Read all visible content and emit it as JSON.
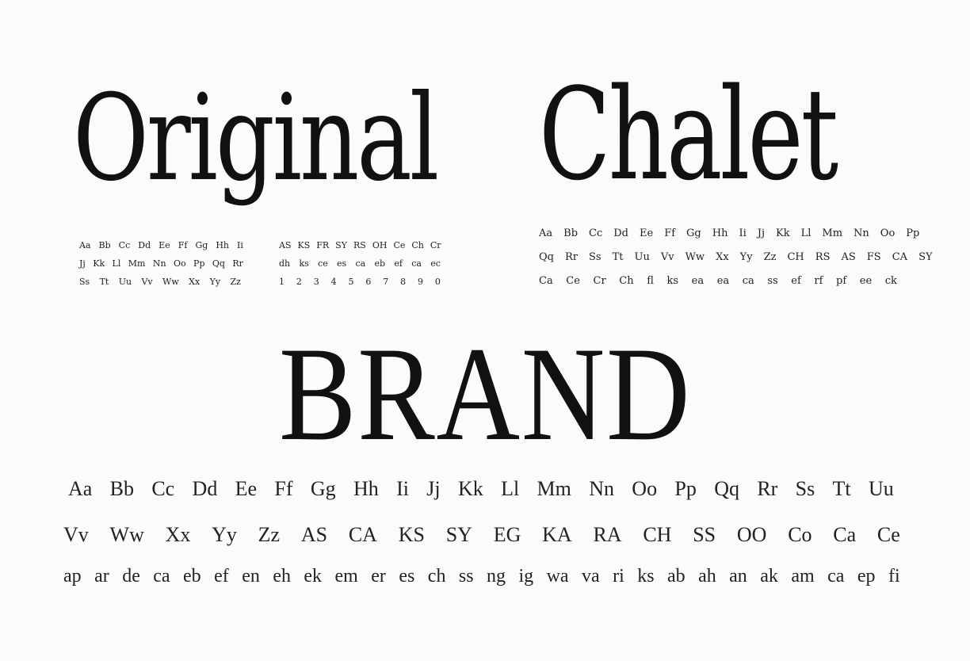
{
  "specimens": {
    "original": {
      "name": "Original",
      "left_rows": [
        [
          "Aa",
          "Bb",
          "Cc",
          "Dd",
          "Ee",
          "Ff",
          "Gg",
          "Hh",
          "Ii"
        ],
        [
          "Jj",
          "Kk",
          "Ll",
          "Mm",
          "Nn",
          "Oo",
          "Pp",
          "Qq",
          "Rr"
        ],
        [
          "Ss",
          "Tt",
          "Uu",
          "Vv",
          "Ww",
          "Xx",
          "Yy",
          "Zz"
        ]
      ],
      "right_rows": [
        [
          "AS",
          "KS",
          "FR",
          "SY",
          "RS",
          "OH",
          "Ce",
          "Ch",
          "Cr"
        ],
        [
          "dh",
          "ks",
          "ce",
          "es",
          "ca",
          "eb",
          "ef",
          "ca",
          "ec"
        ],
        [
          "1",
          "2",
          "3",
          "4",
          "5",
          "6",
          "7",
          "8",
          "9",
          "0"
        ]
      ]
    },
    "chalet": {
      "name": "Chalet",
      "rows": [
        [
          "Aa",
          "Bb",
          "Cc",
          "Dd",
          "Ee",
          "Ff",
          "Gg",
          "Hh",
          "Ii",
          "Jj",
          "Kk",
          "Ll",
          "Mm",
          "Nn",
          "Oo",
          "Pp"
        ],
        [
          "Qq",
          "Rr",
          "Ss",
          "Tt",
          "Uu",
          "Vv",
          "Ww",
          "Xx",
          "Yy",
          "Zz",
          "CH",
          "RS",
          "AS",
          "FS",
          "CA",
          "SY"
        ],
        [
          "Ca",
          "Ce",
          "Cr",
          "Ch",
          "fl",
          "ks",
          "ea",
          "ea",
          "ca",
          "ss",
          "ef",
          "rf",
          "pf",
          "ee",
          "ck"
        ]
      ]
    },
    "brand": {
      "name": "BRAND",
      "alpha_row_1": [
        "Aa",
        "Bb",
        "Cc",
        "Dd",
        "Ee",
        "Ff",
        "Gg",
        "Hh",
        "Ii",
        "Jj",
        "Kk",
        "Ll",
        "Mm",
        "Nn",
        "Oo",
        "Pp",
        "Qq",
        "Rr",
        "Ss",
        "Tt",
        "Uu"
      ],
      "alpha_row_2": [
        "Vv",
        "Ww",
        "Xx",
        "Yy",
        "Zz",
        "AS",
        "CA",
        "KS",
        "SY",
        "EG",
        "KA",
        "RA",
        "CH",
        "SS",
        "OO",
        "Co",
        "Ca",
        "Ce"
      ],
      "ligatures": [
        "ap",
        "ar",
        "de",
        "ca",
        "eb",
        "ef",
        "en",
        "eh",
        "ek",
        "em",
        "er",
        "es",
        "ch",
        "ss",
        "ng",
        "ig",
        "wa",
        "va",
        "ri",
        "ks",
        "ab",
        "ah",
        "an",
        "ak",
        "am",
        "ca",
        "ep",
        "fi"
      ]
    }
  }
}
